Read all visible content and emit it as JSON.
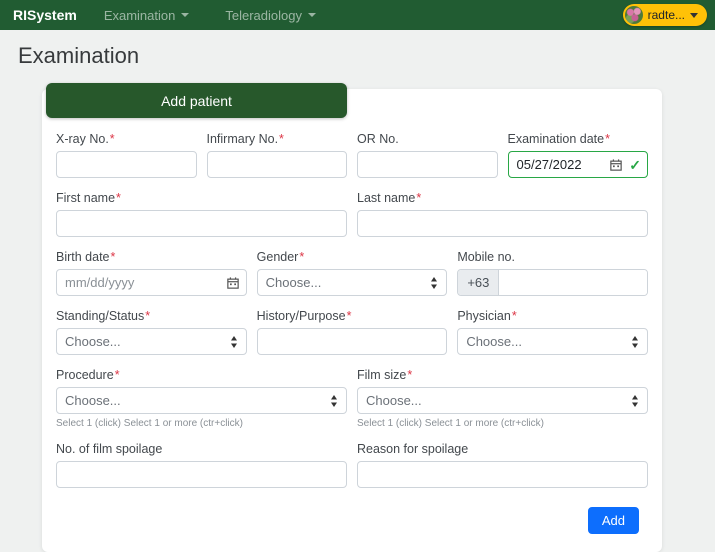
{
  "navbar": {
    "brand": "RISystem",
    "items": [
      {
        "label": "Examination"
      },
      {
        "label": "Teleradiology"
      }
    ],
    "user": {
      "label": "radte..."
    }
  },
  "page": {
    "title": "Examination"
  },
  "form": {
    "header": "Add patient",
    "required_marker": "*",
    "fields": {
      "xray_no": {
        "label": "X-ray No.",
        "required": true,
        "value": ""
      },
      "infirmary_no": {
        "label": "Infirmary No.",
        "required": true,
        "value": ""
      },
      "or_no": {
        "label": "OR No.",
        "required": false,
        "value": ""
      },
      "exam_date": {
        "label": "Examination date",
        "required": true,
        "value": "05/27/2022"
      },
      "first_name": {
        "label": "First name",
        "required": true,
        "value": ""
      },
      "last_name": {
        "label": "Last name",
        "required": true,
        "value": ""
      },
      "birth_date": {
        "label": "Birth date",
        "required": true,
        "placeholder": "mm/dd/yyyy",
        "value": ""
      },
      "gender": {
        "label": "Gender",
        "required": true,
        "value": "Choose..."
      },
      "mobile": {
        "label": "Mobile no.",
        "required": false,
        "prefix": "+63",
        "value": ""
      },
      "standing": {
        "label": "Standing/Status",
        "required": true,
        "value": "Choose..."
      },
      "history": {
        "label": "History/Purpose",
        "required": true,
        "value": ""
      },
      "physician": {
        "label": "Physician",
        "required": true,
        "value": "Choose..."
      },
      "procedure": {
        "label": "Procedure",
        "required": true,
        "value": "Choose...",
        "help": "Select 1 (click) Select 1 or more (ctr+click)"
      },
      "film_size": {
        "label": "Film size",
        "required": true,
        "value": "Choose...",
        "help": "Select 1 (click) Select 1 or more (ctr+click)"
      },
      "film_spoilage": {
        "label": "No. of film spoilage",
        "required": false,
        "value": ""
      },
      "spoilage_reason": {
        "label": "Reason for spoilage",
        "required": false,
        "value": ""
      }
    },
    "submit_label": "Add"
  },
  "icons": {
    "valid_check": "✓"
  },
  "colors": {
    "navbar_green": "#215c32",
    "header_green": "#27582b",
    "accent_blue": "#0d6efd",
    "success_green": "#28a745",
    "warning_yellow": "#ffc107",
    "required_red": "#dc3545",
    "page_background": "#eff1f0"
  }
}
